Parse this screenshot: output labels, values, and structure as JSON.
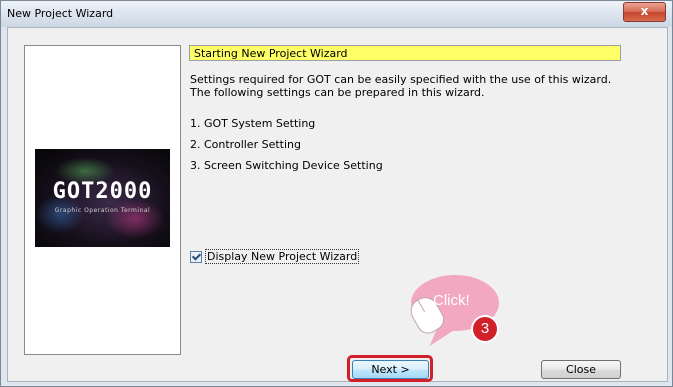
{
  "window": {
    "title": "New Project Wizard",
    "close_glyph": "x"
  },
  "logo": {
    "text": "GOT2000",
    "subtitle": "Graphic Operation Terminal"
  },
  "wizard": {
    "heading": "Starting New Project Wizard",
    "description_line1": "Settings required for GOT can be easily specified with the use of this wizard.",
    "description_line2": "The following settings can be prepared in this wizard.",
    "steps": [
      "1. GOT System Setting",
      "2. Controller Setting",
      "3. Screen Switching Device Setting"
    ],
    "checkbox_label": "Display New Project Wizard",
    "checkbox_checked": true,
    "heading_color": "#ffff66"
  },
  "buttons": {
    "next": "Next >",
    "close": "Close"
  },
  "annotation": {
    "callout_text": "Click!",
    "step_number": "3",
    "highlight_color": "#d0212a",
    "bubble_color": "#f2a8c1"
  }
}
